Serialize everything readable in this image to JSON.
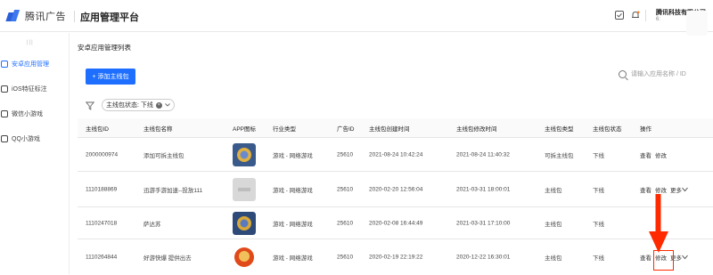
{
  "header": {
    "brand": "腾讯广告",
    "platform": "应用管理平台",
    "company": "腾讯科技有限公司",
    "company_sub": "6:"
  },
  "sidebar": {
    "collapse": "|||",
    "items": [
      {
        "label": "安卓应用管理",
        "active": true
      },
      {
        "label": "iOS特征标注",
        "active": false
      },
      {
        "label": "微信小游戏",
        "active": false
      },
      {
        "label": "QQ小游戏",
        "active": false
      }
    ]
  },
  "main": {
    "list_title": "安卓应用管理列表",
    "add_button": "+ 添加主线包",
    "search_placeholder": "请输入应用名称 / ID",
    "filter_label": "主线包状态: 下线",
    "filter_clear": "×"
  },
  "table": {
    "headers": [
      "主线包ID",
      "主线包名称",
      "APP图标",
      "行业类型",
      "广告ID",
      "主线包创建时间",
      "主线包修改时间",
      "主线包类型",
      "主线包状态",
      "操作"
    ],
    "rows": [
      {
        "id": "2000000974",
        "name": "添加可拆主线包",
        "industry": "游戏 - 网络游戏",
        "ad_id": "25610",
        "created": "2021-08-24 10:42:24",
        "modified": "2021-08-24 11:40:32",
        "type": "可拆主线包",
        "status": "下线",
        "view": "查看",
        "edit": "修改",
        "more": ""
      },
      {
        "id": "1110188869",
        "name": "迅游手游加速--投放111",
        "industry": "游戏 - 网络游戏",
        "ad_id": "25610",
        "created": "2020-02-20 12:56:04",
        "modified": "2021-03-31 18:00:01",
        "type": "主线包",
        "status": "下线",
        "view": "查看",
        "edit": "修改",
        "more": "更多"
      },
      {
        "id": "1110247018",
        "name": "萨达苏",
        "industry": "游戏 - 网络游戏",
        "ad_id": "25610",
        "created": "2020-02-08 16:44:49",
        "modified": "2021-03-31 17:10:00",
        "type": "主线包",
        "status": "下线",
        "view": "",
        "edit": "",
        "more": ""
      },
      {
        "id": "1110264844",
        "name": "好游快爆 提供出去",
        "industry": "游戏 - 网络游戏",
        "ad_id": "25610",
        "created": "2020-02-19 22:19:22",
        "modified": "2020-12-22 16:30:01",
        "type": "主线包",
        "status": "下线",
        "view": "查看",
        "edit": "修改",
        "more": "更多"
      }
    ]
  },
  "colors": {
    "accent": "#1e6fff",
    "annotation": "#ff2a00"
  }
}
